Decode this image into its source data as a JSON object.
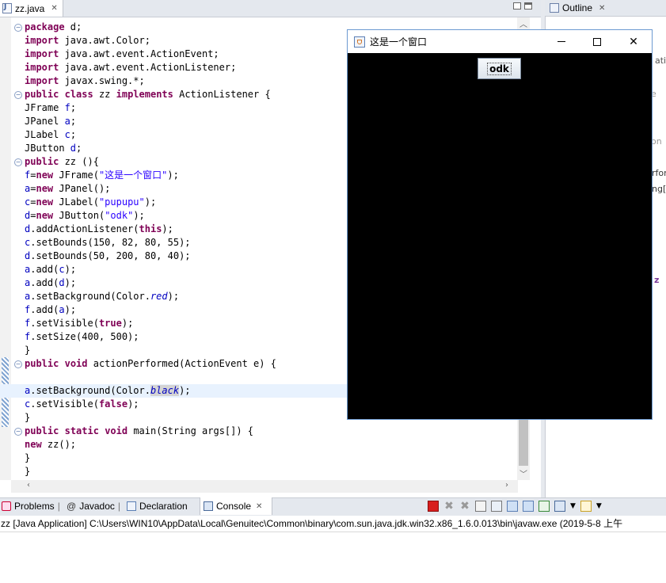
{
  "editor": {
    "tab_label": "zz.java",
    "tab_close": "✕",
    "lines": [
      [
        {
          "t": "package",
          "c": "kw"
        },
        {
          "t": " d;"
        }
      ],
      [
        {
          "t": "import",
          "c": "kw"
        },
        {
          "t": " java.awt.Color;"
        }
      ],
      [
        {
          "t": "import",
          "c": "kw"
        },
        {
          "t": " java.awt.event.ActionEvent;"
        }
      ],
      [
        {
          "t": "import",
          "c": "kw"
        },
        {
          "t": " java.awt.event.ActionListener;"
        }
      ],
      [
        {
          "t": "import",
          "c": "kw"
        },
        {
          "t": " javax.swing.*;"
        }
      ],
      [
        {
          "t": "public",
          "c": "kw"
        },
        {
          "t": " "
        },
        {
          "t": "class",
          "c": "kw"
        },
        {
          "t": " zz "
        },
        {
          "t": "implements",
          "c": "kw"
        },
        {
          "t": " ActionListener {"
        }
      ],
      [
        {
          "t": "JFrame "
        },
        {
          "t": "f",
          "c": "fld"
        },
        {
          "t": ";"
        }
      ],
      [
        {
          "t": "JPanel "
        },
        {
          "t": "a",
          "c": "fld"
        },
        {
          "t": ";"
        }
      ],
      [
        {
          "t": "JLabel "
        },
        {
          "t": "c",
          "c": "fld"
        },
        {
          "t": ";"
        }
      ],
      [
        {
          "t": "JButton "
        },
        {
          "t": "d",
          "c": "fld"
        },
        {
          "t": ";"
        }
      ],
      [
        {
          "t": "public",
          "c": "kw"
        },
        {
          "t": " zz (){"
        }
      ],
      [
        {
          "t": "f",
          "c": "fld"
        },
        {
          "t": "="
        },
        {
          "t": "new",
          "c": "kw"
        },
        {
          "t": " JFrame("
        },
        {
          "t": "\"这是一个窗口\"",
          "c": "str"
        },
        {
          "t": ");"
        }
      ],
      [
        {
          "t": "a",
          "c": "fld"
        },
        {
          "t": "="
        },
        {
          "t": "new",
          "c": "kw"
        },
        {
          "t": " JPanel();"
        }
      ],
      [
        {
          "t": "c",
          "c": "fld"
        },
        {
          "t": "="
        },
        {
          "t": "new",
          "c": "kw"
        },
        {
          "t": " JLabel("
        },
        {
          "t": "\"pupupu\"",
          "c": "str"
        },
        {
          "t": ");"
        }
      ],
      [
        {
          "t": "d",
          "c": "fld"
        },
        {
          "t": "="
        },
        {
          "t": "new",
          "c": "kw"
        },
        {
          "t": " JButton("
        },
        {
          "t": "\"odk\"",
          "c": "str"
        },
        {
          "t": ");"
        }
      ],
      [
        {
          "t": "d",
          "c": "fld"
        },
        {
          "t": ".addActionListener("
        },
        {
          "t": "this",
          "c": "kw"
        },
        {
          "t": ");"
        }
      ],
      [
        {
          "t": "c",
          "c": "fld"
        },
        {
          "t": ".setBounds(150, 82, 80, 55);"
        }
      ],
      [
        {
          "t": "d",
          "c": "fld"
        },
        {
          "t": ".setBounds(50, 200, 80, 40);"
        }
      ],
      [
        {
          "t": "a",
          "c": "fld"
        },
        {
          "t": ".add("
        },
        {
          "t": "c",
          "c": "fld"
        },
        {
          "t": ");"
        }
      ],
      [
        {
          "t": "a",
          "c": "fld"
        },
        {
          "t": ".add("
        },
        {
          "t": "d",
          "c": "fld"
        },
        {
          "t": ");"
        }
      ],
      [
        {
          "t": "a",
          "c": "fld"
        },
        {
          "t": ".setBackground(Color."
        },
        {
          "t": "red",
          "c": "fld ita"
        },
        {
          "t": ");"
        }
      ],
      [
        {
          "t": "f",
          "c": "fld"
        },
        {
          "t": ".add("
        },
        {
          "t": "a",
          "c": "fld"
        },
        {
          "t": ");"
        }
      ],
      [
        {
          "t": "f",
          "c": "fld"
        },
        {
          "t": ".setVisible("
        },
        {
          "t": "true",
          "c": "kw"
        },
        {
          "t": ");"
        }
      ],
      [
        {
          "t": "f",
          "c": "fld"
        },
        {
          "t": ".setSize(400, 500);"
        }
      ],
      [
        {
          "t": "}"
        }
      ],
      [
        {
          "t": "public",
          "c": "kw"
        },
        {
          "t": " "
        },
        {
          "t": "void",
          "c": "kw"
        },
        {
          "t": " actionPerformed(ActionEvent e) {"
        }
      ],
      [
        {
          "t": ""
        }
      ],
      [
        {
          "t": "a",
          "c": "fld"
        },
        {
          "t": ".setBackground(Color."
        },
        {
          "t": "black",
          "c": "fld ita sel"
        },
        {
          "t": ");"
        }
      ],
      [
        {
          "t": "c",
          "c": "fld"
        },
        {
          "t": ".setVisible("
        },
        {
          "t": "false",
          "c": "kw"
        },
        {
          "t": ");"
        }
      ],
      [
        {
          "t": "}"
        }
      ],
      [
        {
          "t": "public",
          "c": "kw"
        },
        {
          "t": " "
        },
        {
          "t": "static",
          "c": "kw"
        },
        {
          "t": " "
        },
        {
          "t": "void",
          "c": "kw"
        },
        {
          "t": " main(String args[]) {"
        }
      ],
      [
        {
          "t": "new",
          "c": "kw"
        },
        {
          "t": " zz();"
        }
      ],
      [
        {
          "t": "}"
        }
      ],
      [
        {
          "t": "}"
        }
      ]
    ]
  },
  "outline": {
    "tab_label": "Outline",
    "tab_close": "✕",
    "fragments": [
      "ati",
      "e",
      "on",
      "rfor",
      "ng[",
      "z"
    ]
  },
  "swing_window": {
    "title": "这是一个窗口",
    "minimize": "—",
    "maximize": "☐",
    "close": "✕",
    "button_label": "odk",
    "panel_color": "#000000"
  },
  "bottom": {
    "tabs": [
      {
        "label": "Problems",
        "icon": "problems-icon"
      },
      {
        "label": "Javadoc",
        "icon": "javadoc-icon"
      },
      {
        "label": "Declaration",
        "icon": "declaration-icon"
      },
      {
        "label": "Console",
        "icon": "console-icon",
        "active": true
      }
    ],
    "tab_close": "✕",
    "console_status": "zz [Java Application] C:\\Users\\WIN10\\AppData\\Local\\Genuitec\\Common\\binary\\com.sun.java.jdk.win32.x86_1.6.0.013\\bin\\javaw.exe (2019-5-8 上午"
  }
}
